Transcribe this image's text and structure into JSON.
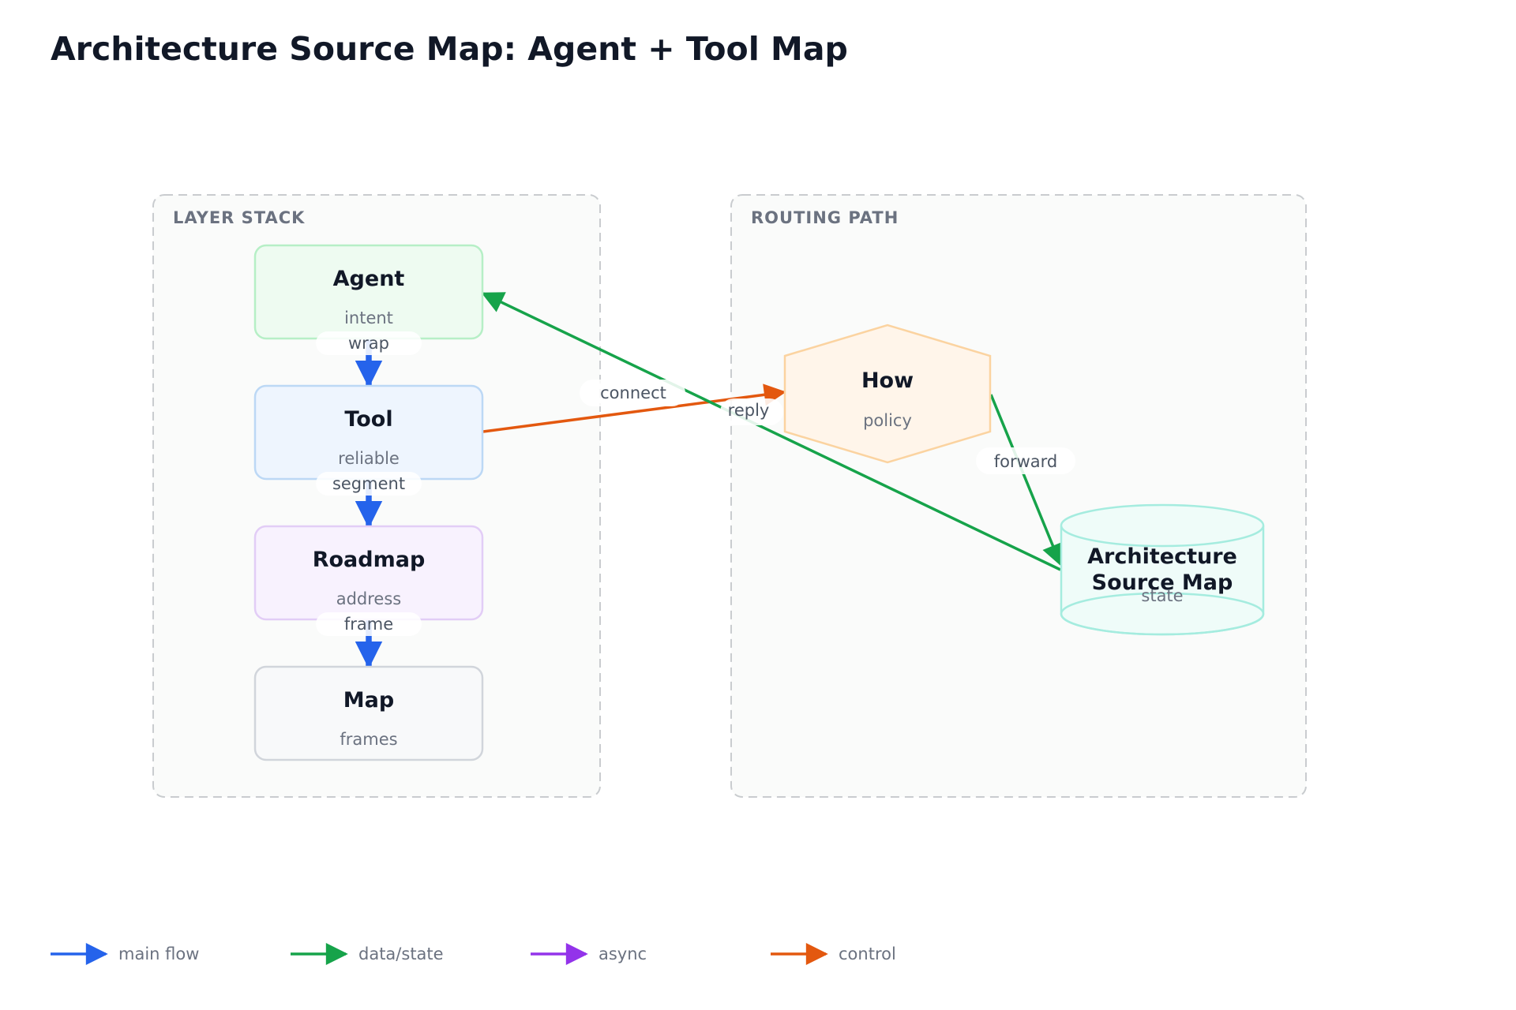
{
  "title": "Architecture Source Map: Agent + Tool Map",
  "groups": {
    "layer_stack": {
      "label": "LAYER STACK"
    },
    "routing_path": {
      "label": "ROUTING PATH"
    }
  },
  "nodes": {
    "agent": {
      "title": "Agent",
      "sub": "intent",
      "fill": "#eefbf1",
      "stroke": "#b6efc6"
    },
    "tool": {
      "title": "Tool",
      "sub": "reliable",
      "fill": "#eef5fe",
      "stroke": "#bcd8f5"
    },
    "roadmap": {
      "title": "Roadmap",
      "sub": "address",
      "fill": "#f8f2fe",
      "stroke": "#e2cdf6"
    },
    "map": {
      "title": "Map",
      "sub": "frames",
      "fill": "#f8f9fa",
      "stroke": "#d1d5db"
    },
    "how": {
      "title": "How",
      "sub": "policy",
      "fill": "#fff5ea",
      "stroke": "#fbd3a0"
    },
    "arch": {
      "title_line1": "Architecture",
      "title_line2": "Source Map",
      "sub": "state",
      "fill": "#effcf9",
      "stroke": "#a5ecdf"
    }
  },
  "edges": {
    "wrap": "wrap",
    "segment": "segment",
    "frame": "frame",
    "connect": "connect",
    "reply": "reply",
    "forward": "forward"
  },
  "colors": {
    "main_flow": "#2563eb",
    "data_state": "#16a34a",
    "async": "#9333ea",
    "control": "#e3580f"
  },
  "legend": [
    {
      "label": "main flow",
      "color": "#2563eb"
    },
    {
      "label": "data/state",
      "color": "#16a34a"
    },
    {
      "label": "async",
      "color": "#9333ea"
    },
    {
      "label": "control",
      "color": "#e3580f"
    }
  ]
}
